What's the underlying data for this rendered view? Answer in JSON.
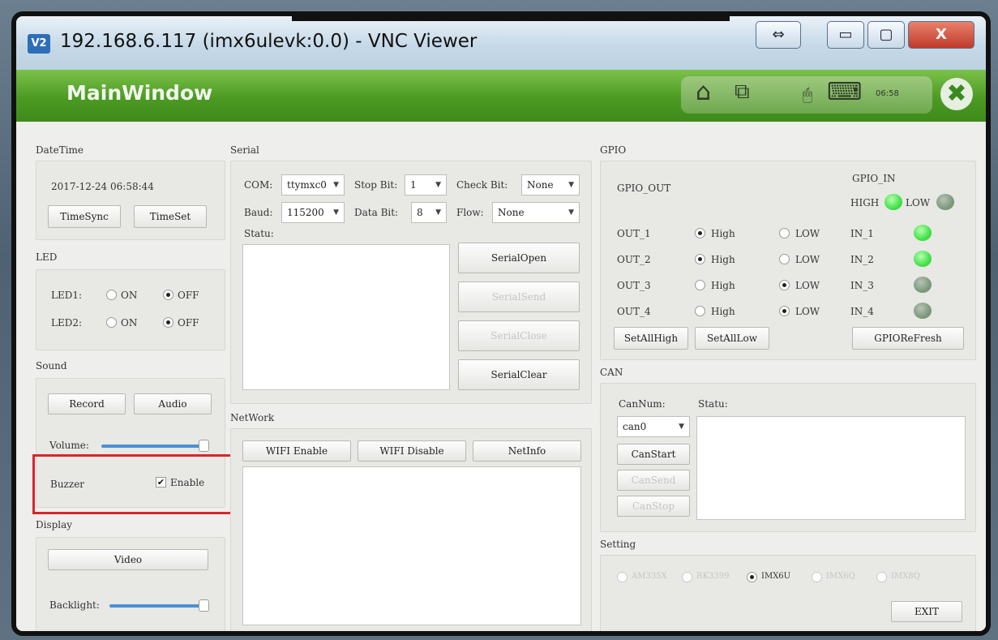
{
  "window": {
    "title": "192.168.6.117 (imx6ulevk:0.0) - VNC Viewer",
    "logo": "V2",
    "buttons": {
      "resize": "⇔",
      "minimize": "▭",
      "maximize": "▢",
      "close": "X"
    }
  },
  "app": {
    "title": "MainWindow",
    "clock": "06:58",
    "icons": [
      "home-icon",
      "window-icon",
      "mouse-icon",
      "keyboard-icon",
      "close-icon"
    ],
    "exit_glyph": "✖",
    "home_glyph": "⌂",
    "window_glyph": "⧉",
    "mouse_glyph": "🖱",
    "keyboard_glyph": "⌨"
  },
  "datetime": {
    "label": "DateTime",
    "value": "2017-12-24 06:58:44",
    "sync_btn": "TimeSync",
    "set_btn": "TimeSet"
  },
  "led": {
    "label": "LED",
    "rows": [
      {
        "name": "LED1:",
        "on": "ON",
        "off": "OFF",
        "selected": "OFF"
      },
      {
        "name": "LED2:",
        "on": "ON",
        "off": "OFF",
        "selected": "OFF"
      }
    ]
  },
  "sound": {
    "label": "Sound",
    "record_btn": "Record",
    "audio_btn": "Audio",
    "volume_label": "Volume:",
    "volume_level": 1.0
  },
  "buzzer": {
    "label": "Buzzer",
    "check_label": "Enable",
    "checked": true,
    "check_glyph": "✔"
  },
  "display": {
    "label": "Display",
    "video_btn": "Video",
    "backlight_label": "Backlight:",
    "backlight_level": 1.0
  },
  "serial": {
    "label": "Serial",
    "com_label": "COM:",
    "com_value": "ttymxc0",
    "stopbit_label": "Stop Bit:",
    "stopbit_value": "1",
    "check_label": "Check Bit:",
    "check_value": "None",
    "baud_label": "Baud:",
    "baud_value": "115200",
    "databit_label": "Data Bit:",
    "databit_value": "8",
    "flow_label": "Flow:",
    "flow_value": "None",
    "status_label": "Statu:",
    "open_btn": "SerialOpen",
    "send_btn": "SerialSend",
    "close_btn": "SerialClose",
    "clear_btn": "SerialClear"
  },
  "network": {
    "label": "NetWork",
    "wifi_enable": "WIFI Enable",
    "wifi_disable": "WIFI Disable",
    "netinfo": "NetInfo"
  },
  "gpio": {
    "label": "GPIO",
    "out_label": "GPIO_OUT",
    "in_label": "GPIO_IN",
    "high_label": "HIGH",
    "low_label": "LOW",
    "outs": [
      {
        "name": "OUT_1",
        "high": "High",
        "low": "LOW",
        "selected": "High"
      },
      {
        "name": "OUT_2",
        "high": "High",
        "low": "LOW",
        "selected": "High"
      },
      {
        "name": "OUT_3",
        "high": "High",
        "low": "LOW",
        "selected": "LOW"
      },
      {
        "name": "OUT_4",
        "high": "High",
        "low": "LOW",
        "selected": "LOW"
      }
    ],
    "ins": [
      {
        "name": "IN_1",
        "state": "high"
      },
      {
        "name": "IN_2",
        "state": "high"
      },
      {
        "name": "IN_3",
        "state": "low"
      },
      {
        "name": "IN_4",
        "state": "low"
      }
    ],
    "set_all_high": "SetAllHigh",
    "set_all_low": "SetAllLow",
    "refresh": "GPIOReFresh"
  },
  "can": {
    "label": "CAN",
    "num_label": "CanNum:",
    "num_value": "can0",
    "status_label": "Statu:",
    "start_btn": "CanStart",
    "send_btn": "CanSend",
    "stop_btn": "CanStop"
  },
  "setting": {
    "label": "Setting",
    "options": [
      {
        "label": "AM335X",
        "enabled": false,
        "selected": false
      },
      {
        "label": "RK3399",
        "enabled": false,
        "selected": false
      },
      {
        "label": "IMX6U",
        "enabled": true,
        "selected": true
      },
      {
        "label": "IMX6Q",
        "enabled": false,
        "selected": false
      },
      {
        "label": "IMX8Q",
        "enabled": false,
        "selected": false
      }
    ],
    "exit_btn": "EXIT"
  },
  "colors": {
    "header_green": "#4c9a23",
    "highlight_red": "#d7262c",
    "led_on": "#44e24a",
    "led_off": "#7d9a7d",
    "slider": "#4e8fd6"
  }
}
